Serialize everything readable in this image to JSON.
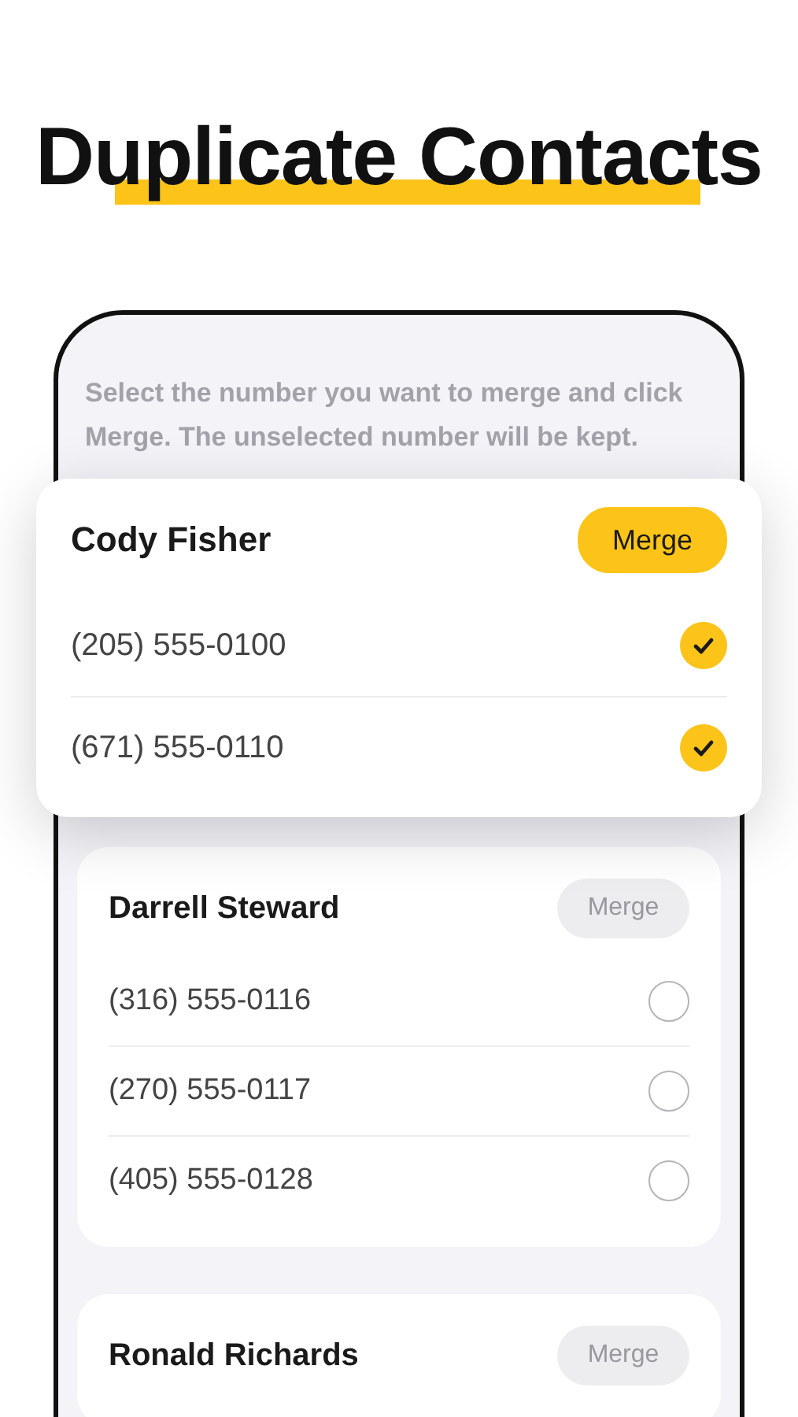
{
  "headline": "Duplicate Contacts",
  "instructions": "Select the number you want to merge and click Merge. The unselected number will be kept.",
  "groups": [
    {
      "name": "Cody Fisher",
      "focused": true,
      "merge": {
        "label": "Merge",
        "disabled": false
      },
      "numbers": [
        {
          "number": "(205) 555-0100",
          "checked": true
        },
        {
          "number": "(671) 555-0110",
          "checked": true
        }
      ]
    },
    {
      "name": "Darrell Steward",
      "focused": false,
      "merge": {
        "label": "Merge",
        "disabled": true
      },
      "numbers": [
        {
          "number": "(316) 555-0116",
          "checked": false
        },
        {
          "number": "(270) 555-0117",
          "checked": false
        },
        {
          "number": "(405) 555-0128",
          "checked": false
        }
      ]
    },
    {
      "name": "Ronald Richards",
      "focused": false,
      "merge": {
        "label": "Merge",
        "disabled": true
      }
    }
  ]
}
